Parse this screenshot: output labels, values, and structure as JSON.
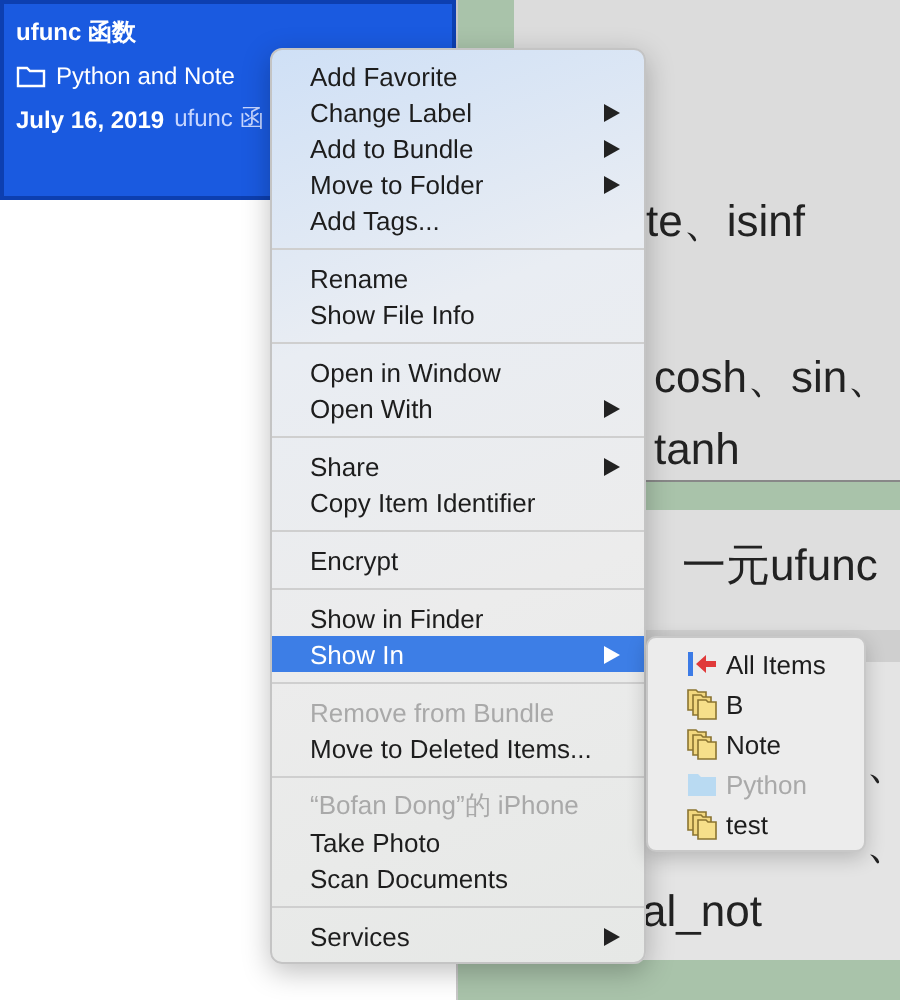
{
  "note_list": {
    "card": {
      "selected": true,
      "title": "ufunc 函数",
      "folder": "Python and Note",
      "date": "July 16, 2019",
      "snippet": "ufunc 函"
    }
  },
  "document": {
    "sections": [
      {
        "kind": "body",
        "lines": [
          "te、isinf",
          "cosh、sin、",
          "tanh"
        ]
      },
      {
        "kind": "heading",
        "lines": [
          "一元ufunc"
        ]
      },
      {
        "kind": "body_tail",
        "lines": [
          "、",
          "、",
          "al_not"
        ]
      }
    ]
  },
  "context_menu": {
    "sections": [
      [
        {
          "kind": "item",
          "label": "Add Favorite",
          "submenu": false,
          "disabled": false,
          "selected": false
        },
        {
          "kind": "item",
          "label": "Change Label",
          "submenu": true,
          "disabled": false,
          "selected": false
        },
        {
          "kind": "item",
          "label": "Add to Bundle",
          "submenu": true,
          "disabled": false,
          "selected": false
        },
        {
          "kind": "item",
          "label": "Move to Folder",
          "submenu": true,
          "disabled": false,
          "selected": false
        },
        {
          "kind": "item",
          "label": "Add Tags...",
          "submenu": false,
          "disabled": false,
          "selected": false
        }
      ],
      [
        {
          "kind": "item",
          "label": "Rename",
          "submenu": false,
          "disabled": false,
          "selected": false
        },
        {
          "kind": "item",
          "label": "Show File Info",
          "submenu": false,
          "disabled": false,
          "selected": false
        }
      ],
      [
        {
          "kind": "item",
          "label": "Open in Window",
          "submenu": false,
          "disabled": false,
          "selected": false
        },
        {
          "kind": "item",
          "label": "Open With",
          "submenu": true,
          "disabled": false,
          "selected": false
        }
      ],
      [
        {
          "kind": "item",
          "label": "Share",
          "submenu": true,
          "disabled": false,
          "selected": false
        },
        {
          "kind": "item",
          "label": "Copy Item Identifier",
          "submenu": false,
          "disabled": false,
          "selected": false
        }
      ],
      [
        {
          "kind": "item",
          "label": "Encrypt",
          "submenu": false,
          "disabled": false,
          "selected": false
        }
      ],
      [
        {
          "kind": "item",
          "label": "Show in Finder",
          "submenu": false,
          "disabled": false,
          "selected": false
        },
        {
          "kind": "item",
          "label": "Show In",
          "submenu": true,
          "disabled": false,
          "selected": true
        }
      ],
      [
        {
          "kind": "item",
          "label": "Remove from Bundle",
          "submenu": false,
          "disabled": true,
          "selected": false
        },
        {
          "kind": "item",
          "label": "Move to Deleted Items...",
          "submenu": false,
          "disabled": false,
          "selected": false
        }
      ],
      [
        {
          "kind": "header",
          "label": "“Bofan Dong”的 iPhone"
        },
        {
          "kind": "item",
          "label": "Take Photo",
          "submenu": false,
          "disabled": false,
          "selected": false
        },
        {
          "kind": "item",
          "label": "Scan Documents",
          "submenu": false,
          "disabled": false,
          "selected": false
        }
      ],
      [
        {
          "kind": "item",
          "label": "Services",
          "submenu": true,
          "disabled": false,
          "selected": false
        }
      ]
    ]
  },
  "submenu": {
    "items": [
      {
        "kind": "all",
        "label": "All Items",
        "disabled": false
      },
      {
        "kind": "bundle",
        "label": "B",
        "disabled": false
      },
      {
        "kind": "bundle",
        "label": "Note",
        "disabled": false
      },
      {
        "kind": "folder",
        "label": "Python",
        "disabled": true
      },
      {
        "kind": "bundle",
        "label": "test",
        "disabled": false
      }
    ]
  }
}
